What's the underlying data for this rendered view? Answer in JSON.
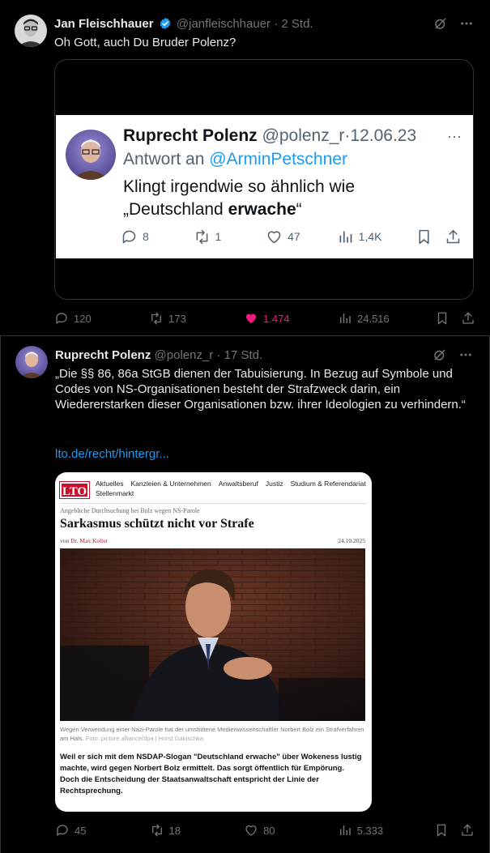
{
  "tweet1": {
    "name": "Jan Fleischhauer",
    "handle": "@janfleischhauer",
    "time": "2 Std.",
    "text": "Oh Gott, auch Du Bruder Polenz?",
    "embedded": {
      "name": "Ruprecht Polenz",
      "handle": "@polenz_r",
      "date": "12.06.23",
      "reply_prefix": "Antwort an",
      "reply_to": "@ArminPetschner",
      "text_line1": "Klingt irgendwie so ähnlich wie",
      "text_line2_pre": "„Deutschland ",
      "text_line2_bold": "erwache",
      "text_line2_post": "“",
      "replies": "8",
      "reposts": "1",
      "likes": "47",
      "views": "1,4K"
    },
    "stats": {
      "replies": "120",
      "reposts": "173",
      "likes": "1.474",
      "views": "24.516"
    }
  },
  "tweet2": {
    "name": "Ruprecht Polenz",
    "handle": "@polenz_r",
    "time": "17 Std.",
    "text": "„Die §§ 86, 86a StGB dienen der Tabuisierung. In Bezug auf Symbole und Codes von NS-Organisationen besteht der Strafzweck darin, ein Wiedererstarken dieser Organisationen bzw. ihrer Ideologien zu verhindern.“",
    "link": "lto.de/recht/hintergr...",
    "article": {
      "logo": "LTO",
      "nav": [
        "Aktuelles",
        "Kanzleien & Unternehmen",
        "Anwaltsberuf",
        "Justiz",
        "Studium & Referendariat",
        "Stellenmarkt"
      ],
      "kicker": "Angebliche Durchsuchung bei Bolz wegen NS-Parole",
      "title": "Sarkasmus schützt nicht vor Strafe",
      "author_prefix": "von",
      "author": "Dr. Max Kolter",
      "date": "24.10.2025",
      "caption": "Wegen Verwendung einer Nazi-Parole hat der umstrittene Medienwissenschaftler Norbert Bolz ein Strafverfahren am Hals.",
      "credit": "Foto: picture alliance/dpa | Horst Galuschka",
      "lead": "Weil er sich mit dem NSDAP-Slogan \"Deutschland erwache\" über Wokeness lustig machte, wird gegen Norbert Bolz ermittelt. Das sorgt öffentlich für Empörung. Doch die Entscheidung der Staatsanwaltschaft entspricht der Linie der Rechtsprechung."
    },
    "stats": {
      "replies": "45",
      "reposts": "18",
      "likes": "80",
      "views": "5.333"
    }
  },
  "colors": {
    "background": "#000000",
    "text": "#e7e9ea",
    "muted": "#71767b",
    "link": "#1d9bf0",
    "like_active": "#f91880",
    "lto_red": "#c8102e"
  },
  "icons": [
    "grok-icon",
    "more-icon",
    "verified-icon",
    "reply-icon",
    "repost-icon",
    "like-icon",
    "views-icon",
    "bookmark-icon",
    "share-icon"
  ]
}
